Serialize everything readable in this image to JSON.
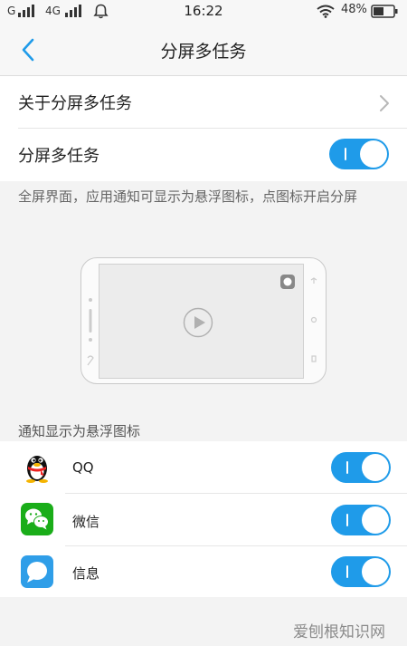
{
  "status_bar": {
    "signal1": "G",
    "signal2": "4G",
    "time": "16:22",
    "battery_text": "48%"
  },
  "nav": {
    "title": "分屏多任务"
  },
  "settings": {
    "about_label": "关于分屏多任务",
    "split_label": "分屏多任务",
    "split_enabled": true,
    "description": "全屏界面，应用通知可显示为悬浮图标，点图标开启分屏"
  },
  "section": {
    "header": "通知显示为悬浮图标"
  },
  "apps": [
    {
      "name": "QQ",
      "icon": "qq-penguin-icon",
      "enabled": true
    },
    {
      "name": "微信",
      "icon": "wechat-icon",
      "enabled": true
    },
    {
      "name": "信息",
      "icon": "messages-icon",
      "enabled": true
    }
  ],
  "colors": {
    "accent": "#1f9be9",
    "wechat": "#1aad19",
    "messages": "#2f9ee8"
  },
  "watermark": "爱刨根知识网"
}
